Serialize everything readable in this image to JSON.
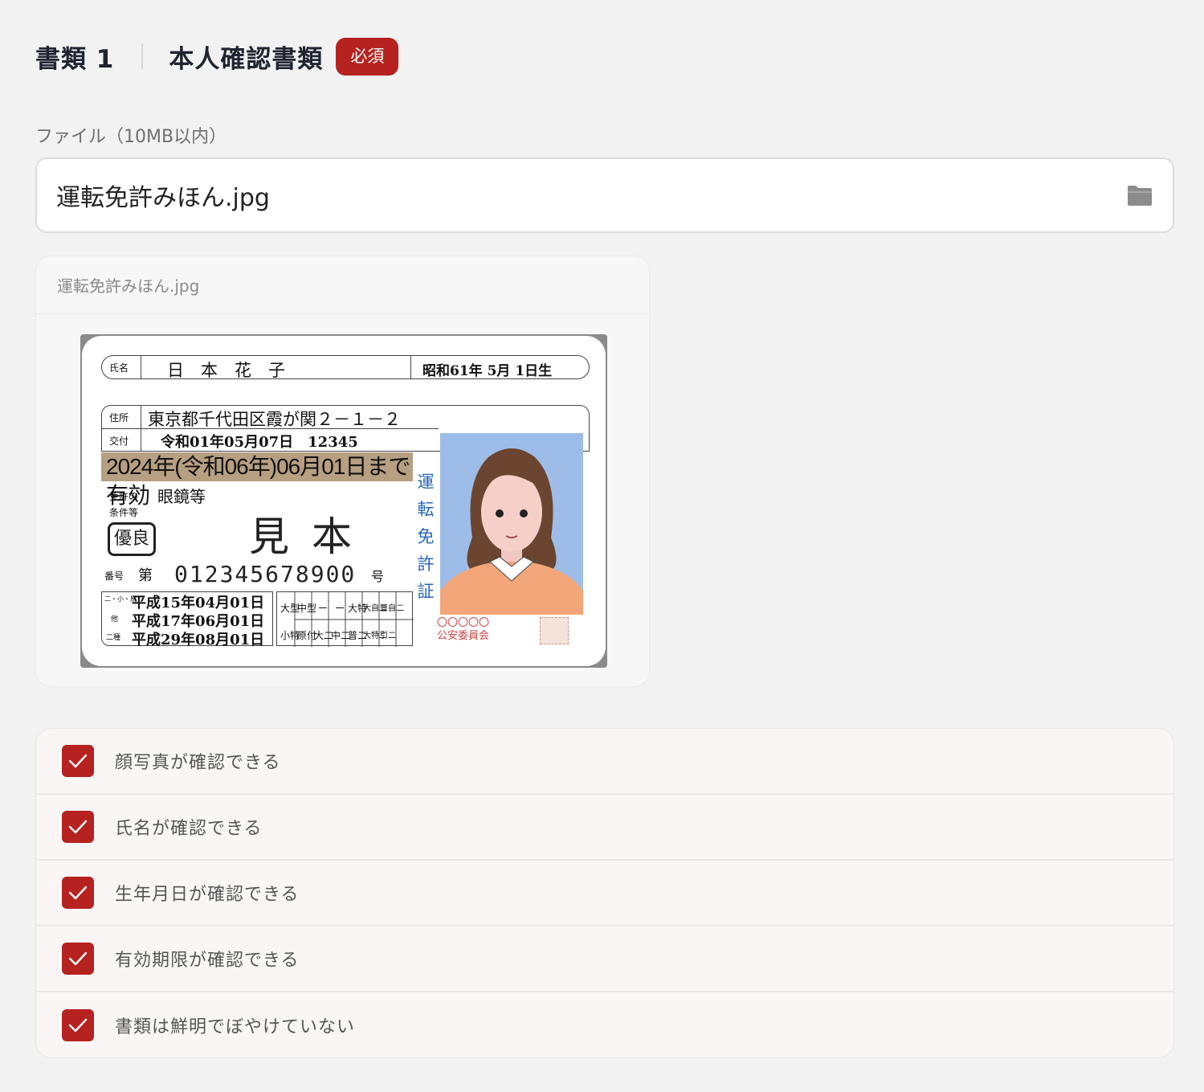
{
  "header": {
    "doc_number": "書類 1",
    "doc_title": "本人確認書類",
    "required_badge": "必須"
  },
  "file_upload": {
    "label": "ファイル（10MB以内）",
    "value": "運転免許みほん.jpg",
    "icon": "folder-icon"
  },
  "preview": {
    "filename": "運転免許みほん.jpg",
    "license": {
      "name_label": "氏名",
      "name": "日　本　花　子",
      "birth": "昭和61年 5月 1日生",
      "address_label": "住所",
      "address": "東京都千代田区霞が関２－１－２",
      "issue_label": "交付",
      "issue": "令和01年05月07日　12345",
      "expiry": "2024年(令和06年)06月01日まで有効",
      "condition_label": "免許の条件等",
      "condition": "眼鏡等",
      "good_badge": "優良",
      "sample": "見本",
      "number_label": "番号",
      "number_prefix": "第",
      "number": "012345678900",
      "number_suffix": "号",
      "vertical_title": "運転免許証",
      "dates": [
        "平成15年04月01日",
        "平成17年06月01日",
        "平成29年08月01日"
      ],
      "date_labels": [
        "二・小・原",
        "他",
        "二種"
      ],
      "category_labels": [
        "大型",
        "中型",
        "ー",
        "ー",
        "大特",
        "大自二",
        "普自二",
        "小特",
        "原付",
        "大二",
        "中二",
        "普二",
        "大特二",
        "引二"
      ],
      "commission": "〇〇〇〇〇\n公安委員会"
    }
  },
  "checklist": [
    {
      "label": "顔写真が確認できる",
      "checked": true
    },
    {
      "label": "氏名が確認できる",
      "checked": true
    },
    {
      "label": "生年月日が確認できる",
      "checked": true
    },
    {
      "label": "有効期限が確認できる",
      "checked": true
    },
    {
      "label": "書類は鮮明でぼやけていない",
      "checked": true
    }
  ],
  "colors": {
    "accent": "#b5221f",
    "background": "#f2f2f2"
  }
}
